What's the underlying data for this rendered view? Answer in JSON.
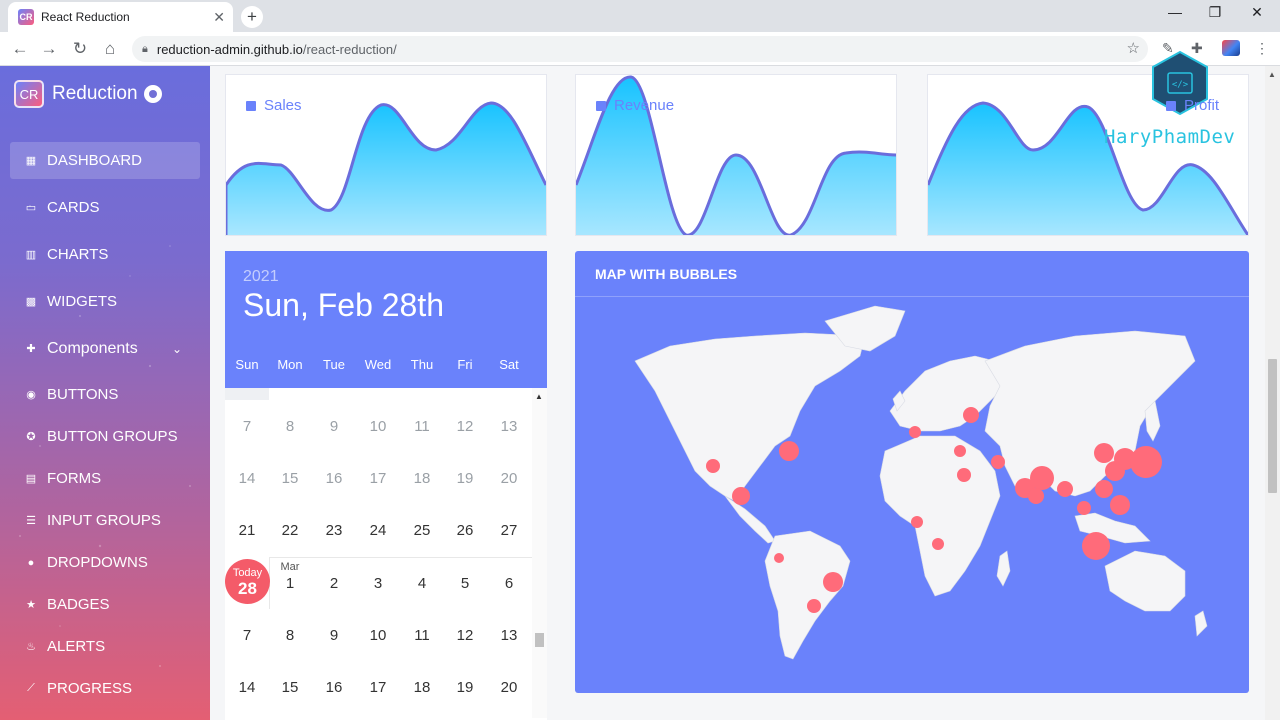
{
  "browser": {
    "tab_title": "React Reduction",
    "tab_favicon": "CR",
    "url_host": "reduction-admin.github.io",
    "url_path": "/react-reduction/"
  },
  "sidebar": {
    "brand": "Reduction",
    "brand_logo": "CR",
    "items": [
      {
        "label": "DASHBOARD",
        "icon": "grid-icon",
        "active": true
      },
      {
        "label": "CARDS",
        "icon": "card-icon"
      },
      {
        "label": "CHARTS",
        "icon": "bar-chart-icon"
      },
      {
        "label": "WIDGETS",
        "icon": "widgets-icon"
      },
      {
        "label": "Components",
        "icon": "puzzle-icon"
      },
      {
        "label": "BUTTONS",
        "icon": "radio-icon"
      },
      {
        "label": "BUTTON GROUPS",
        "icon": "group-icon"
      },
      {
        "label": "FORMS",
        "icon": "form-icon"
      },
      {
        "label": "INPUT GROUPS",
        "icon": "list-icon"
      },
      {
        "label": "DROPDOWNS",
        "icon": "chevron-circle-icon"
      },
      {
        "label": "BADGES",
        "icon": "star-icon"
      },
      {
        "label": "ALERTS",
        "icon": "bell-icon"
      },
      {
        "label": "PROGRESS",
        "icon": "brush-icon"
      }
    ]
  },
  "charts": {
    "sales_title": "Sales",
    "revenue_title": "Revenue",
    "profit_title": "Profit",
    "colors": {
      "fill_top": "#18c3ff",
      "fill_bottom": "#a9e7ff",
      "line": "#6a6ddc"
    }
  },
  "calendar": {
    "year": "2021",
    "date": "Sun, Feb 28th",
    "weekdays": [
      "Sun",
      "Mon",
      "Tue",
      "Wed",
      "Thu",
      "Fri",
      "Sat"
    ],
    "weeks": [
      [
        "7",
        "8",
        "9",
        "10",
        "11",
        "12",
        "13"
      ],
      [
        "14",
        "15",
        "16",
        "17",
        "18",
        "19",
        "20"
      ],
      [
        "21",
        "22",
        "23",
        "24",
        "25",
        "26",
        "27"
      ],
      [
        "",
        "1",
        "2",
        "3",
        "4",
        "5",
        "6"
      ],
      [
        "7",
        "8",
        "9",
        "10",
        "11",
        "12",
        "13"
      ],
      [
        "14",
        "15",
        "16",
        "17",
        "18",
        "19",
        "20"
      ]
    ],
    "month_tag": "Mar",
    "today_label": "Today",
    "today_day": "28"
  },
  "map": {
    "title": "MAP WITH BUBBLES",
    "bubble_color": "#ff6b7a"
  },
  "watermark": "HaryPhamDev"
}
